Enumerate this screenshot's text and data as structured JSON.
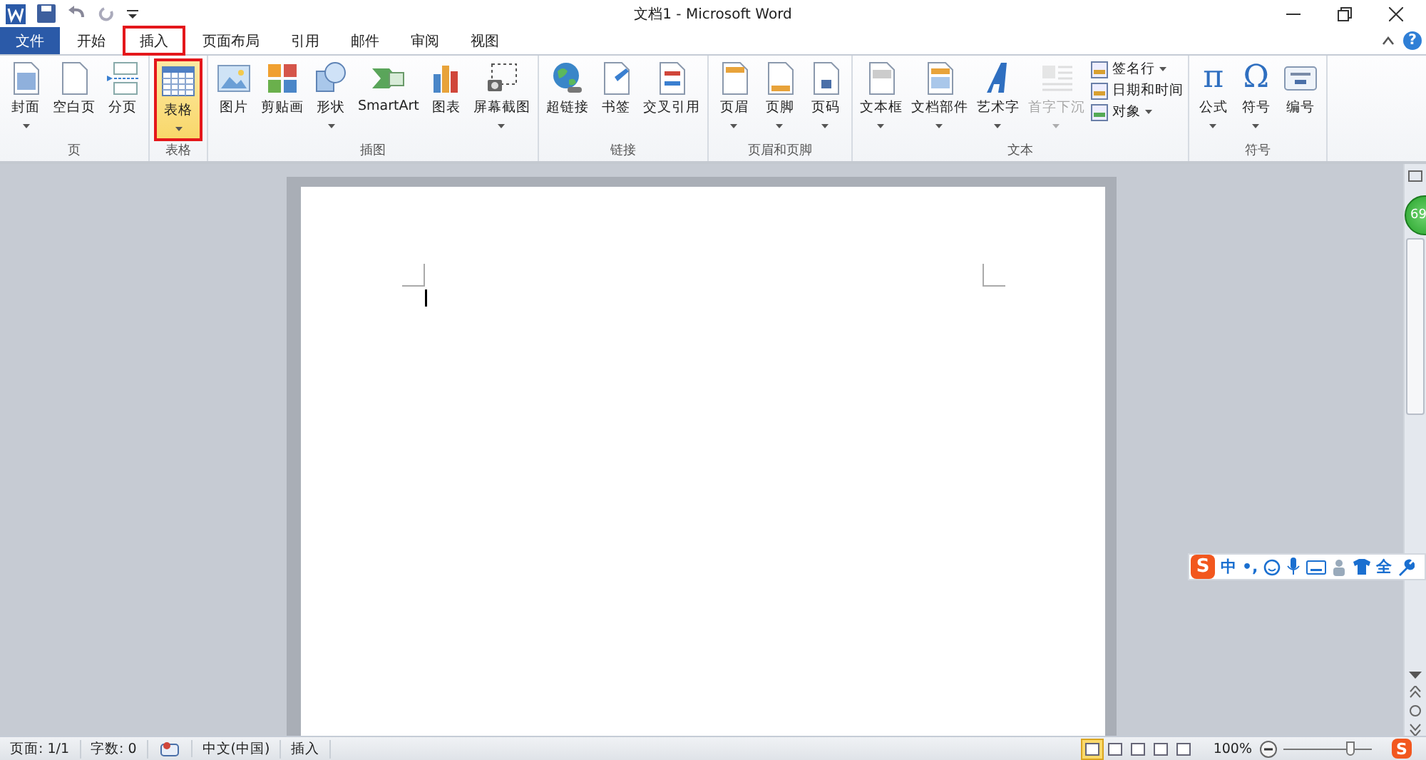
{
  "window": {
    "title": "文档1  -  Microsoft Word",
    "help_glyph": "?"
  },
  "tabs": [
    {
      "label": "文件",
      "kind": "file",
      "selected": false
    },
    {
      "label": "开始",
      "kind": "tab",
      "selected": false,
      "annotated": false
    },
    {
      "label": "插入",
      "kind": "tab",
      "selected": true,
      "annotated": true
    },
    {
      "label": "页面布局",
      "kind": "tab",
      "selected": false,
      "annotated": false
    },
    {
      "label": "引用",
      "kind": "tab",
      "selected": false,
      "annotated": false
    },
    {
      "label": "邮件",
      "kind": "tab",
      "selected": false,
      "annotated": false
    },
    {
      "label": "审阅",
      "kind": "tab",
      "selected": false,
      "annotated": false
    },
    {
      "label": "视图",
      "kind": "tab",
      "selected": false,
      "annotated": false
    }
  ],
  "ribbon": {
    "groups": [
      {
        "label": "页",
        "buttons": [
          {
            "label": "封面",
            "menu": true,
            "disabled": false,
            "selected": false,
            "annotated": false
          },
          {
            "label": "空白页",
            "menu": false,
            "disabled": false,
            "selected": false,
            "annotated": false
          },
          {
            "label": "分页",
            "menu": false,
            "disabled": false,
            "selected": false,
            "annotated": false
          }
        ]
      },
      {
        "label": "表格",
        "buttons": [
          {
            "label": "表格",
            "menu": true,
            "disabled": false,
            "selected": true,
            "annotated": true
          }
        ]
      },
      {
        "label": "插图",
        "buttons": [
          {
            "label": "图片",
            "menu": false,
            "disabled": false,
            "selected": false,
            "annotated": false
          },
          {
            "label": "剪贴画",
            "menu": false,
            "disabled": false,
            "selected": false,
            "annotated": false
          },
          {
            "label": "形状",
            "menu": true,
            "disabled": false,
            "selected": false,
            "annotated": false
          },
          {
            "label": "SmartArt",
            "menu": false,
            "disabled": false,
            "selected": false,
            "annotated": false
          },
          {
            "label": "图表",
            "menu": false,
            "disabled": false,
            "selected": false,
            "annotated": false
          },
          {
            "label": "屏幕截图",
            "menu": true,
            "disabled": false,
            "selected": false,
            "annotated": false
          }
        ]
      },
      {
        "label": "链接",
        "buttons": [
          {
            "label": "超链接",
            "menu": false,
            "disabled": false,
            "selected": false,
            "annotated": false
          },
          {
            "label": "书签",
            "menu": false,
            "disabled": false,
            "selected": false,
            "annotated": false
          },
          {
            "label": "交叉引用",
            "menu": false,
            "disabled": false,
            "selected": false,
            "annotated": false
          }
        ]
      },
      {
        "label": "页眉和页脚",
        "buttons": [
          {
            "label": "页眉",
            "menu": true,
            "disabled": false,
            "selected": false,
            "annotated": false
          },
          {
            "label": "页脚",
            "menu": true,
            "disabled": false,
            "selected": false,
            "annotated": false
          },
          {
            "label": "页码",
            "menu": true,
            "disabled": false,
            "selected": false,
            "annotated": false
          }
        ]
      },
      {
        "label": "文本",
        "buttons": [
          {
            "label": "文本框",
            "menu": true,
            "disabled": false,
            "selected": false,
            "annotated": false
          },
          {
            "label": "文档部件",
            "menu": true,
            "disabled": false,
            "selected": false,
            "annotated": false
          },
          {
            "label": "艺术字",
            "menu": true,
            "disabled": false,
            "selected": false,
            "annotated": false
          },
          {
            "label": "首字下沉",
            "menu": true,
            "disabled": true,
            "selected": false,
            "annotated": false
          }
        ],
        "small_buttons": [
          {
            "label": "签名行",
            "menu": true
          },
          {
            "label": "日期和时间",
            "menu": false
          },
          {
            "label": "对象",
            "menu": true
          }
        ]
      },
      {
        "label": "符号",
        "buttons": [
          {
            "label": "公式",
            "glyph": "π",
            "menu": true,
            "disabled": false,
            "selected": false,
            "annotated": false
          },
          {
            "label": "符号",
            "glyph": "Ω",
            "menu": true,
            "disabled": false,
            "selected": false,
            "annotated": false
          },
          {
            "label": "编号",
            "menu": false,
            "disabled": false,
            "selected": false,
            "annotated": false
          }
        ]
      }
    ]
  },
  "floating_ball": {
    "text": "69"
  },
  "ime_toolbar": {
    "logo": "S",
    "mode": "中",
    "punct": "•,",
    "width": "全"
  },
  "status_bar": {
    "left": [
      "页面: 1/1",
      "字数: 0",
      "中文(中国)",
      "插入"
    ],
    "zoom": "100%",
    "zoom_slider": {
      "level": 0.75
    },
    "logo": "S"
  }
}
